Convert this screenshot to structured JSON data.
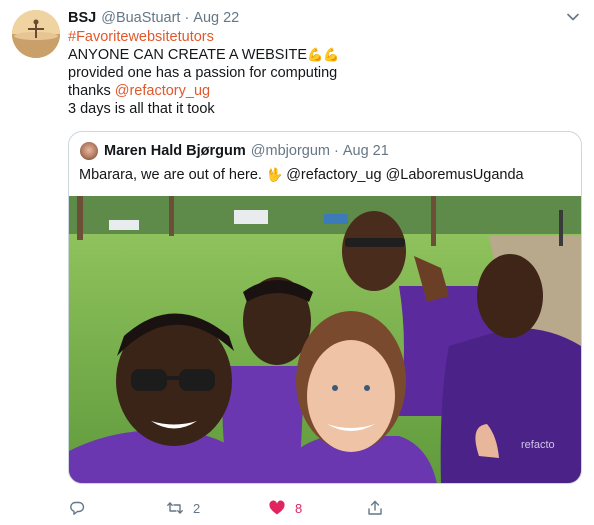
{
  "tweet": {
    "display_name": "BSJ",
    "handle": "@BuaStuart",
    "separator": "·",
    "date": "Aug 22",
    "lines": {
      "hashtag": "#Favoritewebsitetutors",
      "line2_text": "ANYONE CAN CREATE A WEBSITE",
      "line2_emoji": "💪💪",
      "line3": "provided one has a passion for computing",
      "line4_text": "thanks ",
      "line4_mention": "@refactory_ug",
      "line5": "3 days is all that it took"
    },
    "icons": {
      "more": "chevron-down-icon"
    }
  },
  "quoted_tweet": {
    "display_name": "Maren Hald Bjørgum",
    "handle": "@mbjorgum",
    "separator": "·",
    "date": "Aug 21",
    "text_before": "Mbarara, we are out of here. ",
    "emoji": "🖖",
    "text_after": " @refactory_ug @LaboremusUganda"
  },
  "actions": {
    "reply_count": "",
    "retweet_count": "2",
    "like_count": "8",
    "icons": [
      "reply-icon",
      "retweet-icon",
      "heart-icon",
      "share-icon"
    ]
  },
  "colors": {
    "link": "#e0582c",
    "muted": "#657786",
    "like": "#e0245e",
    "shirt": "#5b2b9e"
  }
}
